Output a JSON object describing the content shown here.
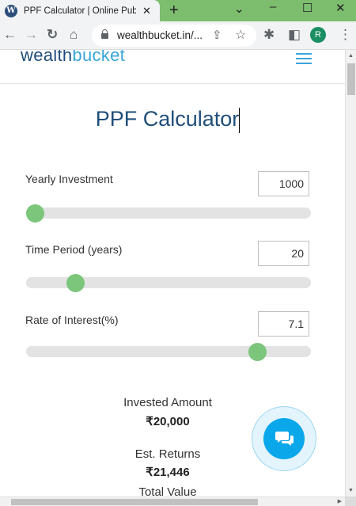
{
  "browser": {
    "tab_title": "PPF Calculator | Online Public",
    "tab_favicon_letter": "W",
    "new_tab": "+",
    "url": "wealthbucket.in/...",
    "profile_initial": "R",
    "theme_color": "#7dbd6e"
  },
  "header": {
    "logo_part1": "wealth",
    "logo_part2": "bucket"
  },
  "calculator": {
    "title": "PPF Calculator",
    "yearly_investment": {
      "label": "Yearly Investment",
      "value": "1000",
      "slider_fraction": 0.0
    },
    "time_period": {
      "label": "Time Period (years)",
      "value": "20",
      "slider_fraction": 0.15
    },
    "rate_of_interest": {
      "label": "Rate of Interest(%)",
      "value": "7.1",
      "slider_fraction": 0.83
    }
  },
  "results": {
    "invested_amount_label": "Invested Amount",
    "invested_amount_value": "₹20,000",
    "est_returns_label": "Est. Returns",
    "est_returns_value": "₹21,446",
    "total_value_label": "Total Value"
  },
  "colors": {
    "slider_thumb": "#7bc67b",
    "title": "#1f4e79",
    "chat_button": "#0aa7ea"
  }
}
